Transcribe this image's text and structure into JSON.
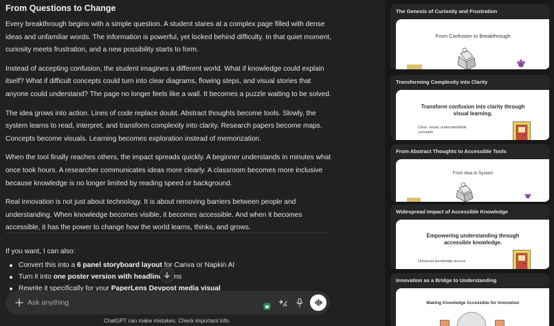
{
  "article": {
    "title": "From Questions to Change",
    "paragraphs": [
      "Every breakthrough begins with a simple question. A student stares at a complex page filled with dense ideas and unfamiliar words. The information is powerful, yet locked behind difficulty. In that quiet moment, curiosity meets frustration, and a new possibility starts to form.",
      "Instead of accepting confusion, the student imagines a different world. What if knowledge could explain itself? What if difficult concepts could turn into clear diagrams, flowing steps, and visual stories that anyone could understand? The page no longer feels like a wall. It becomes a puzzle waiting to be solved.",
      "The idea grows into action. Lines of code replace doubt. Abstract thoughts become tools. Slowly, the system learns to read, interpret, and transform complexity into clarity. Research papers become maps. Concepts become visuals. Learning becomes exploration instead of memorization.",
      "When the tool finally reaches others, the impact spreads quickly. A beginner understands in minutes what once took hours. A researcher communicates ideas more clearly. A classroom becomes more inclusive because knowledge is no longer limited by reading speed or background.",
      "Real innovation is not just about technology. It is about removing barriers between people and understanding. When knowledge becomes visible, it becomes accessible. And when it becomes accessible, it has the power to change how the world learns, thinks, and grows."
    ]
  },
  "followups": {
    "intro": "If you want, I can also:",
    "items": [
      {
        "pre": "Convert this into a ",
        "bold": "6 panel storyboard layout",
        "post": " for Canva or Napkin AI"
      },
      {
        "pre": "Turn it into ",
        "bold": "one poster version with headline + ",
        "post": "ons"
      },
      {
        "pre": "Rewrite it specifically for your ",
        "bold": "PaperLens Devpost media visual",
        "post": ""
      }
    ]
  },
  "composer": {
    "placeholder": "Ask anything"
  },
  "disclaimer": "ChatGPT can make mistakes. Check important info.",
  "panel": {
    "cards": [
      {
        "title": "The Genesis of Curiosity and Frustration",
        "heading": "From Confusion to Breakthrough",
        "note": ""
      },
      {
        "title": "Transforming Complexity into Clarity",
        "heading": "Transform confusion into clarity through visual learning.",
        "note": "Clear, visual, understandable concepts"
      },
      {
        "title": "From Abstract Thoughts to Accessible Tools",
        "heading": "From Idea to System",
        "note": ""
      },
      {
        "title": "Widespread Impact of Accessible Knowledge",
        "heading": "Empowering understanding through accessible knowledge.",
        "note": "Universal knowledge access"
      },
      {
        "title": "Innovation as a Bridge to Understanding",
        "heading": "Making Knowledge Accessible for Innovation",
        "note": ""
      }
    ]
  },
  "colors": {
    "background": "#212121",
    "panel": "#171717",
    "card": "#262626",
    "composer": "#303030",
    "text": "#ececec",
    "door_yellow": "#f2d54a",
    "door_red": "#c64a3c",
    "flower_purple": "#7e4a9e"
  },
  "icons": [
    "plus-icon",
    "arrow-down-icon",
    "app-badge-icon",
    "sparkle-icon",
    "microphone-icon",
    "voice-waveform-icon"
  ]
}
